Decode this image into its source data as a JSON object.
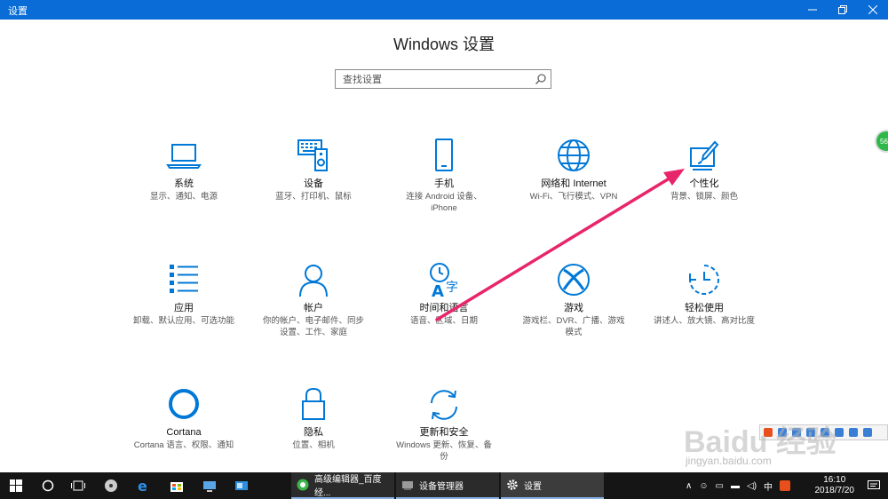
{
  "window": {
    "title": "设置",
    "controls": [
      "minimize",
      "maximize",
      "close"
    ]
  },
  "page_title": "Windows 设置",
  "search": {
    "placeholder": "查找设置"
  },
  "settings": [
    {
      "name": "系统",
      "desc": [
        "显示、通知、电源"
      ],
      "icon": "laptop-icon"
    },
    {
      "name": "设备",
      "desc": [
        "蓝牙、打印机、鼠标"
      ],
      "icon": "devices-icon"
    },
    {
      "name": "手机",
      "desc": [
        "连接 Android 设备、",
        "iPhone"
      ],
      "icon": "phone-icon"
    },
    {
      "name": "网络和 Internet",
      "desc": [
        "Wi-Fi、飞行模式、VPN"
      ],
      "icon": "globe-icon"
    },
    {
      "name": "个性化",
      "desc": [
        "背景、锁屏、颜色"
      ],
      "icon": "paint-icon"
    },
    {
      "name": "应用",
      "desc": [
        "卸载、默认应用、可选功能"
      ],
      "icon": "apps-icon"
    },
    {
      "name": "帐户",
      "desc": [
        "你的帐户、电子邮件、同步",
        "设置、工作、家庭"
      ],
      "icon": "person-icon"
    },
    {
      "name": "时间和语言",
      "desc": [
        "语音、区域、日期"
      ],
      "icon": "time-language-icon"
    },
    {
      "name": "游戏",
      "desc": [
        "游戏栏、DVR、广播、游戏",
        "模式"
      ],
      "icon": "xbox-icon"
    },
    {
      "name": "轻松使用",
      "desc": [
        "讲述人、放大镜、高对比度"
      ],
      "icon": "ease-of-access-icon"
    },
    {
      "name": "Cortana",
      "desc": [
        "Cortana 语言、权限、通知"
      ],
      "icon": "cortana-icon"
    },
    {
      "name": "隐私",
      "desc": [
        "位置、相机"
      ],
      "icon": "lock-icon"
    },
    {
      "name": "更新和安全",
      "desc": [
        "Windows 更新、恢复、备",
        "份"
      ],
      "icon": "update-icon"
    }
  ],
  "side_badge": "56",
  "taskbar": {
    "tasks": [
      {
        "label": "高级编辑器_百度经...",
        "icon": "browser-icon"
      },
      {
        "label": "设备管理器",
        "icon": "device-manager-icon"
      },
      {
        "label": "设置",
        "icon": "gear-icon"
      }
    ],
    "tray": {
      "ime": "中",
      "time": "16:10",
      "date": "2018/7/20"
    }
  },
  "watermark": {
    "logo": "Baidu 经验",
    "url": "jingyan.baidu.com"
  },
  "colors": {
    "accent": "#0a6cd6",
    "icon_blue": "#0078d7",
    "arrow": "#e8246a",
    "taskbar": "#151515"
  }
}
